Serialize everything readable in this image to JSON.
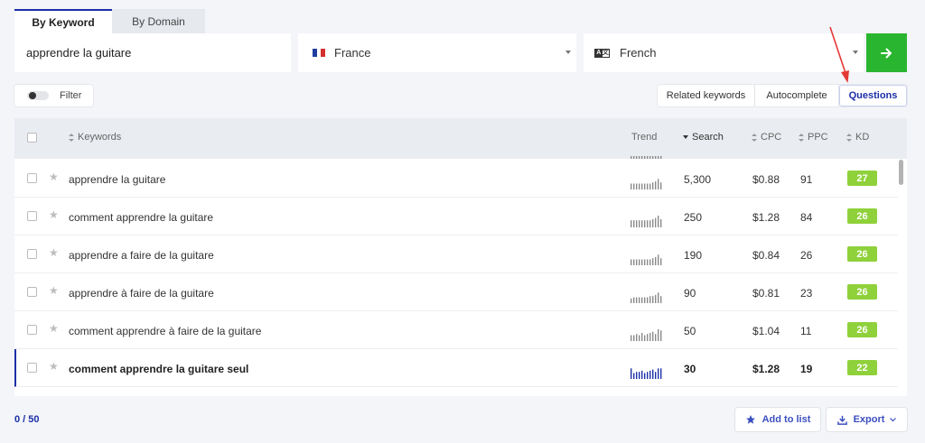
{
  "tabs": [
    {
      "label": "By Keyword",
      "active": true
    },
    {
      "label": "By Domain",
      "active": false
    }
  ],
  "search": {
    "keyword": "apprendre la guitare"
  },
  "country": {
    "label": "France"
  },
  "language": {
    "label": "French"
  },
  "filter": {
    "label": "Filter"
  },
  "modes": [
    {
      "label": "Related keywords",
      "active": false
    },
    {
      "label": "Autocomplete",
      "active": false
    },
    {
      "label": "Questions",
      "active": true
    }
  ],
  "table": {
    "headers": {
      "keywords": "Keywords",
      "trend": "Trend",
      "search": "Search",
      "cpc": "CPC",
      "ppc": "PPC",
      "kd": "KD"
    },
    "rows": [
      {
        "keyword": "apprendre la guitare",
        "search": "5,300",
        "cpc": "$0.88",
        "ppc": "91",
        "kd": "27",
        "trend": [
          0.5,
          0.5,
          0.5,
          0.5,
          0.5,
          0.5,
          0.5,
          0.5,
          0.6,
          0.7,
          0.9,
          0.6
        ]
      },
      {
        "keyword": "comment apprendre la guitare",
        "search": "250",
        "cpc": "$1.28",
        "ppc": "84",
        "kd": "26",
        "trend": [
          0.6,
          0.6,
          0.6,
          0.6,
          0.6,
          0.6,
          0.6,
          0.6,
          0.7,
          0.8,
          1.0,
          0.7
        ]
      },
      {
        "keyword": "apprendre a faire de la guitare",
        "search": "190",
        "cpc": "$0.84",
        "ppc": "26",
        "kd": "26",
        "trend": [
          0.5,
          0.5,
          0.5,
          0.5,
          0.5,
          0.5,
          0.5,
          0.5,
          0.6,
          0.7,
          0.9,
          0.6
        ]
      },
      {
        "keyword": "apprendre à faire de la guitare",
        "search": "90",
        "cpc": "$0.81",
        "ppc": "23",
        "kd": "26",
        "trend": [
          0.4,
          0.5,
          0.5,
          0.5,
          0.5,
          0.5,
          0.5,
          0.6,
          0.6,
          0.7,
          0.9,
          0.6
        ]
      },
      {
        "keyword": "comment apprendre à faire de la guitare",
        "search": "50",
        "cpc": "$1.04",
        "ppc": "11",
        "kd": "26",
        "trend": [
          0.5,
          0.5,
          0.6,
          0.5,
          0.7,
          0.5,
          0.6,
          0.7,
          0.8,
          0.6,
          1.0,
          0.9
        ]
      },
      {
        "keyword": "comment apprendre la guitare seul",
        "search": "30",
        "cpc": "$1.28",
        "ppc": "19",
        "kd": "22",
        "highlight": true,
        "trend": [
          0.9,
          0.5,
          0.6,
          0.6,
          0.7,
          0.5,
          0.6,
          0.7,
          0.8,
          0.6,
          0.9,
          0.9
        ]
      }
    ]
  },
  "footer": {
    "count": "0 / 50",
    "add_label": "Add to list",
    "export_label": "Export"
  },
  "colors": {
    "accent": "#1c2fa8",
    "go": "#2ab530",
    "kd": "#8fd13a",
    "arrow": "#e53935",
    "trend": "#8a8a8a",
    "trend_highlight": "#1c2fa8"
  }
}
